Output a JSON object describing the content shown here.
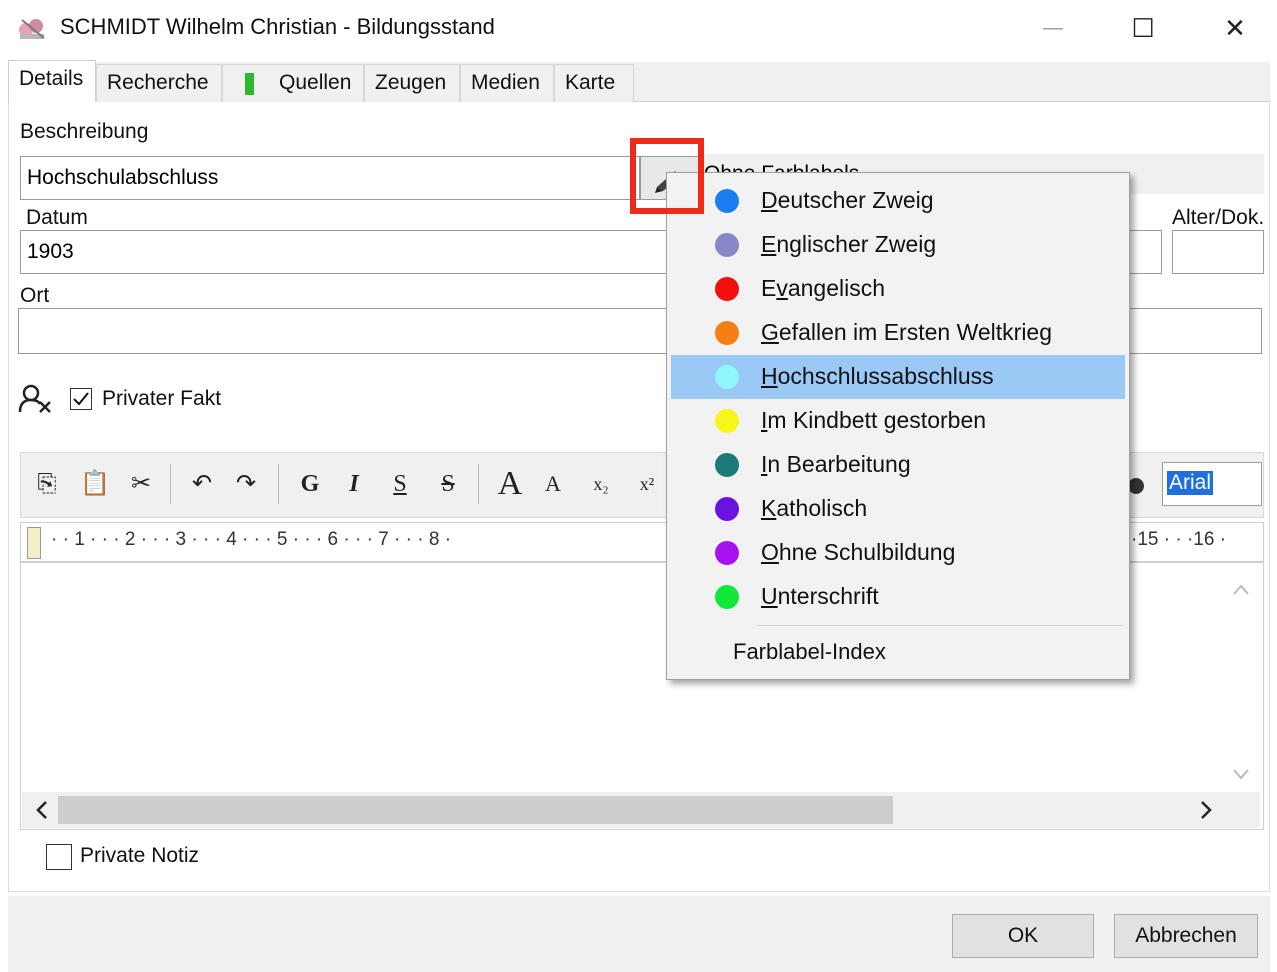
{
  "window": {
    "title": "SCHMIDT Wilhelm Christian - Bildungsstand",
    "minimize": "—",
    "maximize": "☐",
    "close": "✕"
  },
  "tabs": [
    {
      "label": "Details",
      "active": true
    },
    {
      "label": "Recherche"
    },
    {
      "label": "Quellen"
    },
    {
      "label": "Zeugen"
    },
    {
      "label": "Medien"
    },
    {
      "label": "Karte"
    }
  ],
  "form": {
    "beschreibung_label": "Beschreibung",
    "beschreibung_value": "Hochschulabschluss",
    "farblabel_text": "Ohne Farblabels",
    "datum_label": "Datum",
    "datum_value": "1903",
    "alter_label": "Alter/Dok.",
    "ort_label": "Ort",
    "ort_value": "",
    "privater_fakt_label": "Privater Fakt",
    "privater_fakt_checked": true
  },
  "toolbar": {
    "copy": "⎘",
    "paste": "📋",
    "cut": "✂",
    "undo": "↶",
    "redo": "↷",
    "bold": "G",
    "italic": "I",
    "underline": "S",
    "strike": "S",
    "grow": "A",
    "shrink": "A",
    "subscript": "x₂",
    "superscript": "x²",
    "font_value": "Arial"
  },
  "ruler": {
    "left_marks": "· · 1 · · · 2 · · · 3 · · · 4 · · · 5 · · · 6 · · · 7 · · · 8 ·",
    "right_marks": "·15 · · ·16 ·"
  },
  "private_notiz_label": "Private Notiz",
  "buttons": {
    "ok": "OK",
    "cancel": "Abbrechen"
  },
  "menu": {
    "items": [
      {
        "pre": "",
        "u": "D",
        "post": "eutscher Zweig",
        "color": "#1a7df0"
      },
      {
        "pre": "",
        "u": "E",
        "post": "nglischer Zweig",
        "color": "#8888c9"
      },
      {
        "pre": "E",
        "u": "v",
        "post": "angelisch",
        "color": "#f01010"
      },
      {
        "pre": "",
        "u": "G",
        "post": "efallen im Ersten Weltkrieg",
        "color": "#f57f17"
      },
      {
        "pre": "",
        "u": "H",
        "post": "ochschlussabschluss",
        "color": "#8ff7ff",
        "selected": true
      },
      {
        "pre": "",
        "u": "I",
        "post": "m Kindbett gestorben",
        "color": "#f6f61a"
      },
      {
        "pre": "",
        "u": "I",
        "post": "n Bearbeitung",
        "color": "#1b7a78"
      },
      {
        "pre": "",
        "u": "K",
        "post": "atholisch",
        "color": "#6a12e0"
      },
      {
        "pre": "",
        "u": "O",
        "post": "hne Schulbildung",
        "color": "#a912f0"
      },
      {
        "pre": "",
        "u": "U",
        "post": "nterschrift",
        "color": "#12e83a"
      }
    ],
    "index_label": "Farblabel-Index"
  },
  "colors": {
    "highlight": "#ee2a19",
    "selected_item": "#99c9f4"
  }
}
